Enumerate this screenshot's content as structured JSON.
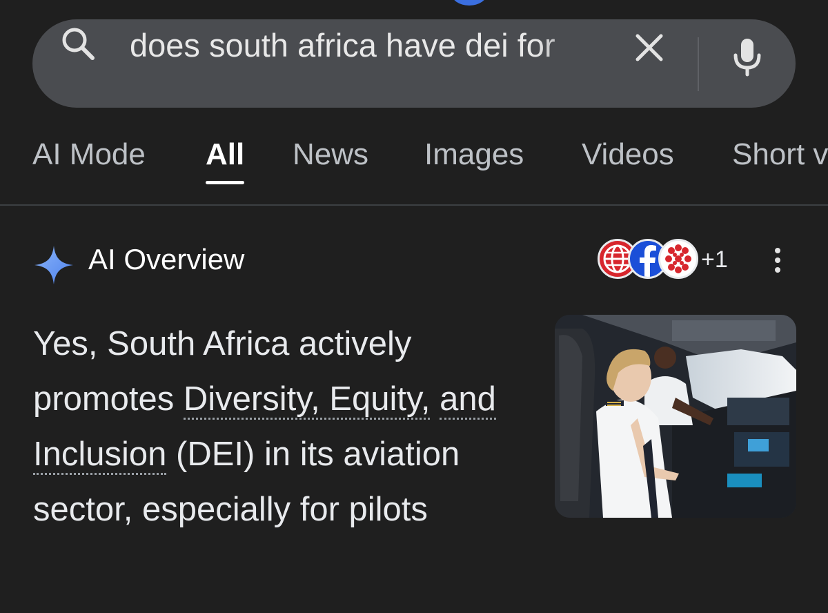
{
  "search": {
    "query": "does south africa have dei for",
    "search_icon": "search-icon",
    "clear_icon": "close-icon",
    "mic_icon": "mic-icon"
  },
  "tabs": [
    {
      "label": "AI Mode",
      "active": false
    },
    {
      "label": "All",
      "active": true
    },
    {
      "label": "News",
      "active": false
    },
    {
      "label": "Images",
      "active": false
    },
    {
      "label": "Videos",
      "active": false
    },
    {
      "label": "Short v",
      "active": false
    }
  ],
  "ai_overview": {
    "title": "AI Overview",
    "sources_more": "+1",
    "answer": {
      "part1": "Yes, South Africa actively promotes ",
      "link1": "Diversity, Equity,",
      "part2": " ",
      "link2": "and Inclusion",
      "part3": " (DEI) in its aviation sector, especially for pilots"
    }
  },
  "colors": {
    "background": "#1f1f1f",
    "search_bar": "#4a4c50",
    "sparkle": "#6f9cf6",
    "active_tab": "#ffffff",
    "inactive_tab": "#bdc1c6"
  }
}
